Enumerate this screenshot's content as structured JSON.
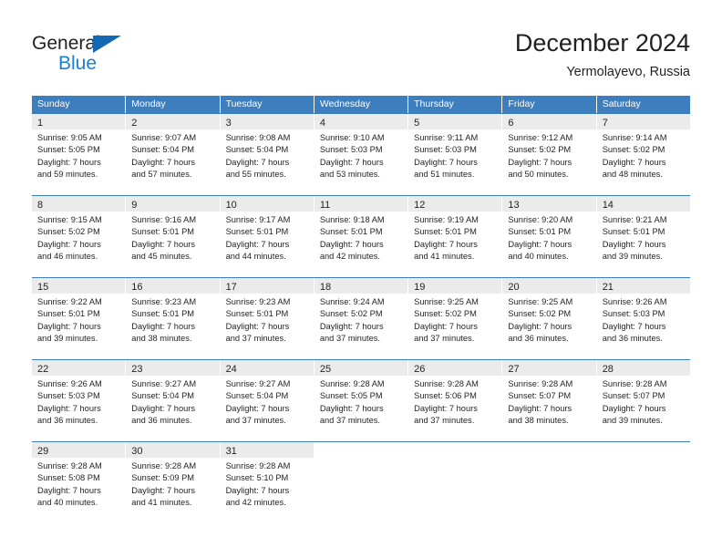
{
  "brand": {
    "name_part1": "General",
    "name_part2": "Blue",
    "accent_color": "#1268b3",
    "blue_text_color": "#1b7fd4"
  },
  "header": {
    "title": "December 2024",
    "subtitle": "Yermolayevo, Russia"
  },
  "theme": {
    "header_bar_color": "#3d7ebe",
    "daynum_band_color": "#f1f1f1",
    "text_color": "#231f20"
  },
  "weekdays": [
    "Sunday",
    "Monday",
    "Tuesday",
    "Wednesday",
    "Thursday",
    "Friday",
    "Saturday"
  ],
  "weeks": [
    [
      {
        "day": "1",
        "sunrise": "Sunrise: 9:05 AM",
        "sunset": "Sunset: 5:05 PM",
        "daylight1": "Daylight: 7 hours",
        "daylight2": "and 59 minutes."
      },
      {
        "day": "2",
        "sunrise": "Sunrise: 9:07 AM",
        "sunset": "Sunset: 5:04 PM",
        "daylight1": "Daylight: 7 hours",
        "daylight2": "and 57 minutes."
      },
      {
        "day": "3",
        "sunrise": "Sunrise: 9:08 AM",
        "sunset": "Sunset: 5:04 PM",
        "daylight1": "Daylight: 7 hours",
        "daylight2": "and 55 minutes."
      },
      {
        "day": "4",
        "sunrise": "Sunrise: 9:10 AM",
        "sunset": "Sunset: 5:03 PM",
        "daylight1": "Daylight: 7 hours",
        "daylight2": "and 53 minutes."
      },
      {
        "day": "5",
        "sunrise": "Sunrise: 9:11 AM",
        "sunset": "Sunset: 5:03 PM",
        "daylight1": "Daylight: 7 hours",
        "daylight2": "and 51 minutes."
      },
      {
        "day": "6",
        "sunrise": "Sunrise: 9:12 AM",
        "sunset": "Sunset: 5:02 PM",
        "daylight1": "Daylight: 7 hours",
        "daylight2": "and 50 minutes."
      },
      {
        "day": "7",
        "sunrise": "Sunrise: 9:14 AM",
        "sunset": "Sunset: 5:02 PM",
        "daylight1": "Daylight: 7 hours",
        "daylight2": "and 48 minutes."
      }
    ],
    [
      {
        "day": "8",
        "sunrise": "Sunrise: 9:15 AM",
        "sunset": "Sunset: 5:02 PM",
        "daylight1": "Daylight: 7 hours",
        "daylight2": "and 46 minutes."
      },
      {
        "day": "9",
        "sunrise": "Sunrise: 9:16 AM",
        "sunset": "Sunset: 5:01 PM",
        "daylight1": "Daylight: 7 hours",
        "daylight2": "and 45 minutes."
      },
      {
        "day": "10",
        "sunrise": "Sunrise: 9:17 AM",
        "sunset": "Sunset: 5:01 PM",
        "daylight1": "Daylight: 7 hours",
        "daylight2": "and 44 minutes."
      },
      {
        "day": "11",
        "sunrise": "Sunrise: 9:18 AM",
        "sunset": "Sunset: 5:01 PM",
        "daylight1": "Daylight: 7 hours",
        "daylight2": "and 42 minutes."
      },
      {
        "day": "12",
        "sunrise": "Sunrise: 9:19 AM",
        "sunset": "Sunset: 5:01 PM",
        "daylight1": "Daylight: 7 hours",
        "daylight2": "and 41 minutes."
      },
      {
        "day": "13",
        "sunrise": "Sunrise: 9:20 AM",
        "sunset": "Sunset: 5:01 PM",
        "daylight1": "Daylight: 7 hours",
        "daylight2": "and 40 minutes."
      },
      {
        "day": "14",
        "sunrise": "Sunrise: 9:21 AM",
        "sunset": "Sunset: 5:01 PM",
        "daylight1": "Daylight: 7 hours",
        "daylight2": "and 39 minutes."
      }
    ],
    [
      {
        "day": "15",
        "sunrise": "Sunrise: 9:22 AM",
        "sunset": "Sunset: 5:01 PM",
        "daylight1": "Daylight: 7 hours",
        "daylight2": "and 39 minutes."
      },
      {
        "day": "16",
        "sunrise": "Sunrise: 9:23 AM",
        "sunset": "Sunset: 5:01 PM",
        "daylight1": "Daylight: 7 hours",
        "daylight2": "and 38 minutes."
      },
      {
        "day": "17",
        "sunrise": "Sunrise: 9:23 AM",
        "sunset": "Sunset: 5:01 PM",
        "daylight1": "Daylight: 7 hours",
        "daylight2": "and 37 minutes."
      },
      {
        "day": "18",
        "sunrise": "Sunrise: 9:24 AM",
        "sunset": "Sunset: 5:02 PM",
        "daylight1": "Daylight: 7 hours",
        "daylight2": "and 37 minutes."
      },
      {
        "day": "19",
        "sunrise": "Sunrise: 9:25 AM",
        "sunset": "Sunset: 5:02 PM",
        "daylight1": "Daylight: 7 hours",
        "daylight2": "and 37 minutes."
      },
      {
        "day": "20",
        "sunrise": "Sunrise: 9:25 AM",
        "sunset": "Sunset: 5:02 PM",
        "daylight1": "Daylight: 7 hours",
        "daylight2": "and 36 minutes."
      },
      {
        "day": "21",
        "sunrise": "Sunrise: 9:26 AM",
        "sunset": "Sunset: 5:03 PM",
        "daylight1": "Daylight: 7 hours",
        "daylight2": "and 36 minutes."
      }
    ],
    [
      {
        "day": "22",
        "sunrise": "Sunrise: 9:26 AM",
        "sunset": "Sunset: 5:03 PM",
        "daylight1": "Daylight: 7 hours",
        "daylight2": "and 36 minutes."
      },
      {
        "day": "23",
        "sunrise": "Sunrise: 9:27 AM",
        "sunset": "Sunset: 5:04 PM",
        "daylight1": "Daylight: 7 hours",
        "daylight2": "and 36 minutes."
      },
      {
        "day": "24",
        "sunrise": "Sunrise: 9:27 AM",
        "sunset": "Sunset: 5:04 PM",
        "daylight1": "Daylight: 7 hours",
        "daylight2": "and 37 minutes."
      },
      {
        "day": "25",
        "sunrise": "Sunrise: 9:28 AM",
        "sunset": "Sunset: 5:05 PM",
        "daylight1": "Daylight: 7 hours",
        "daylight2": "and 37 minutes."
      },
      {
        "day": "26",
        "sunrise": "Sunrise: 9:28 AM",
        "sunset": "Sunset: 5:06 PM",
        "daylight1": "Daylight: 7 hours",
        "daylight2": "and 37 minutes."
      },
      {
        "day": "27",
        "sunrise": "Sunrise: 9:28 AM",
        "sunset": "Sunset: 5:07 PM",
        "daylight1": "Daylight: 7 hours",
        "daylight2": "and 38 minutes."
      },
      {
        "day": "28",
        "sunrise": "Sunrise: 9:28 AM",
        "sunset": "Sunset: 5:07 PM",
        "daylight1": "Daylight: 7 hours",
        "daylight2": "and 39 minutes."
      }
    ],
    [
      {
        "day": "29",
        "sunrise": "Sunrise: 9:28 AM",
        "sunset": "Sunset: 5:08 PM",
        "daylight1": "Daylight: 7 hours",
        "daylight2": "and 40 minutes."
      },
      {
        "day": "30",
        "sunrise": "Sunrise: 9:28 AM",
        "sunset": "Sunset: 5:09 PM",
        "daylight1": "Daylight: 7 hours",
        "daylight2": "and 41 minutes."
      },
      {
        "day": "31",
        "sunrise": "Sunrise: 9:28 AM",
        "sunset": "Sunset: 5:10 PM",
        "daylight1": "Daylight: 7 hours",
        "daylight2": "and 42 minutes."
      },
      {
        "day": "",
        "sunrise": "",
        "sunset": "",
        "daylight1": "",
        "daylight2": ""
      },
      {
        "day": "",
        "sunrise": "",
        "sunset": "",
        "daylight1": "",
        "daylight2": ""
      },
      {
        "day": "",
        "sunrise": "",
        "sunset": "",
        "daylight1": "",
        "daylight2": ""
      },
      {
        "day": "",
        "sunrise": "",
        "sunset": "",
        "daylight1": "",
        "daylight2": ""
      }
    ]
  ]
}
